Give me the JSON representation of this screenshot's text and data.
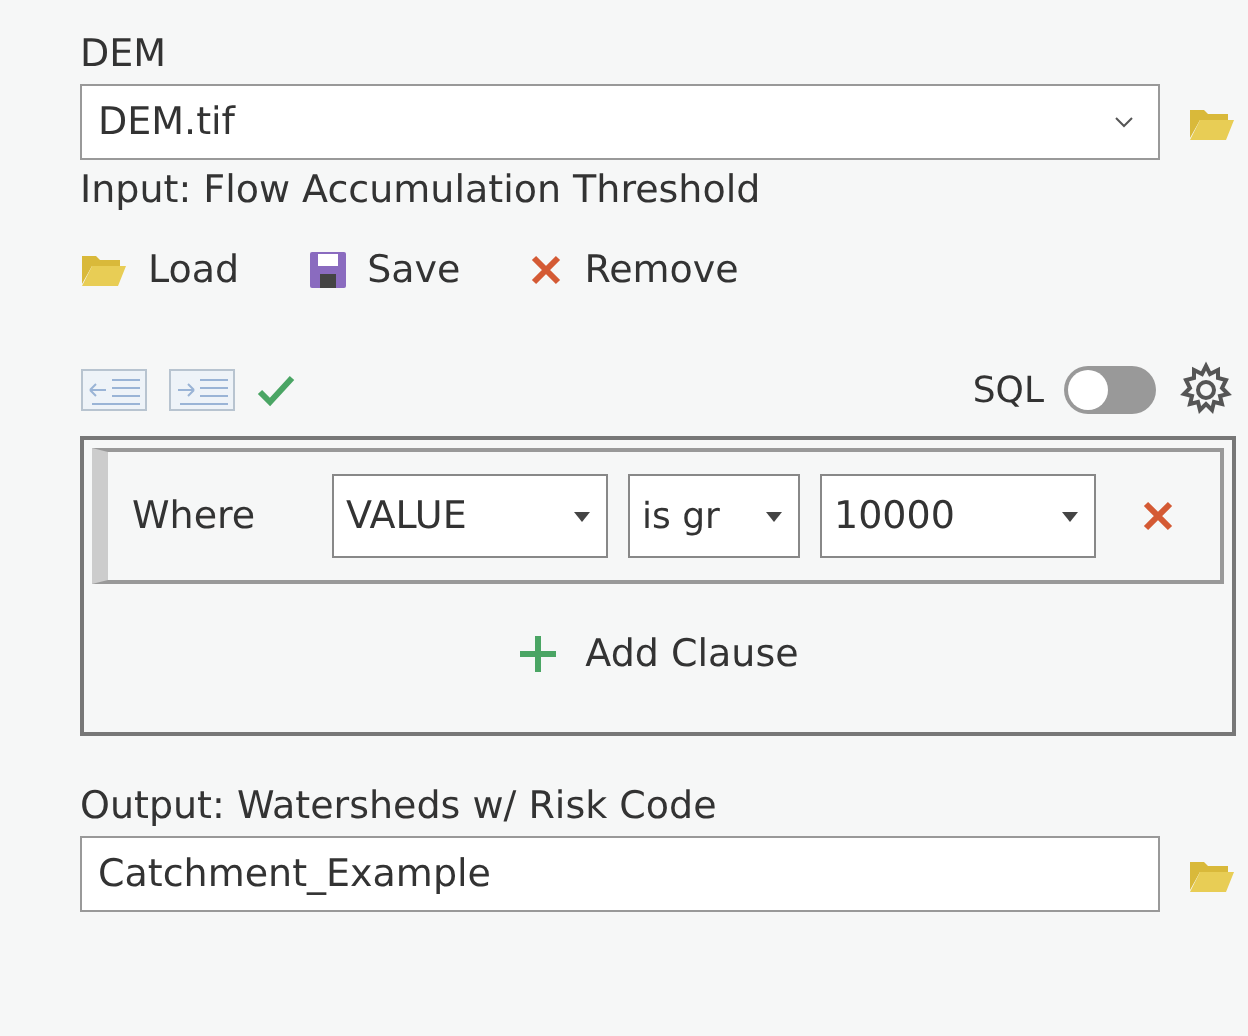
{
  "dem": {
    "label": "DEM",
    "value": "DEM.tif"
  },
  "threshold_label": "Input: Flow Accumulation Threshold",
  "actions": [
    {
      "kind": "load",
      "label": "Load"
    },
    {
      "kind": "save",
      "label": "Save"
    },
    {
      "kind": "remove",
      "label": "Remove"
    }
  ],
  "sql": {
    "label": "SQL",
    "on": false
  },
  "clauses": [
    {
      "keyword": "Where",
      "field": "VALUE",
      "operator": "is gr",
      "value": "10000"
    }
  ],
  "add_clause": "Add Clause",
  "output": {
    "label": "Output: Watersheds w/ Risk Code",
    "value": "Catchment_Example"
  }
}
